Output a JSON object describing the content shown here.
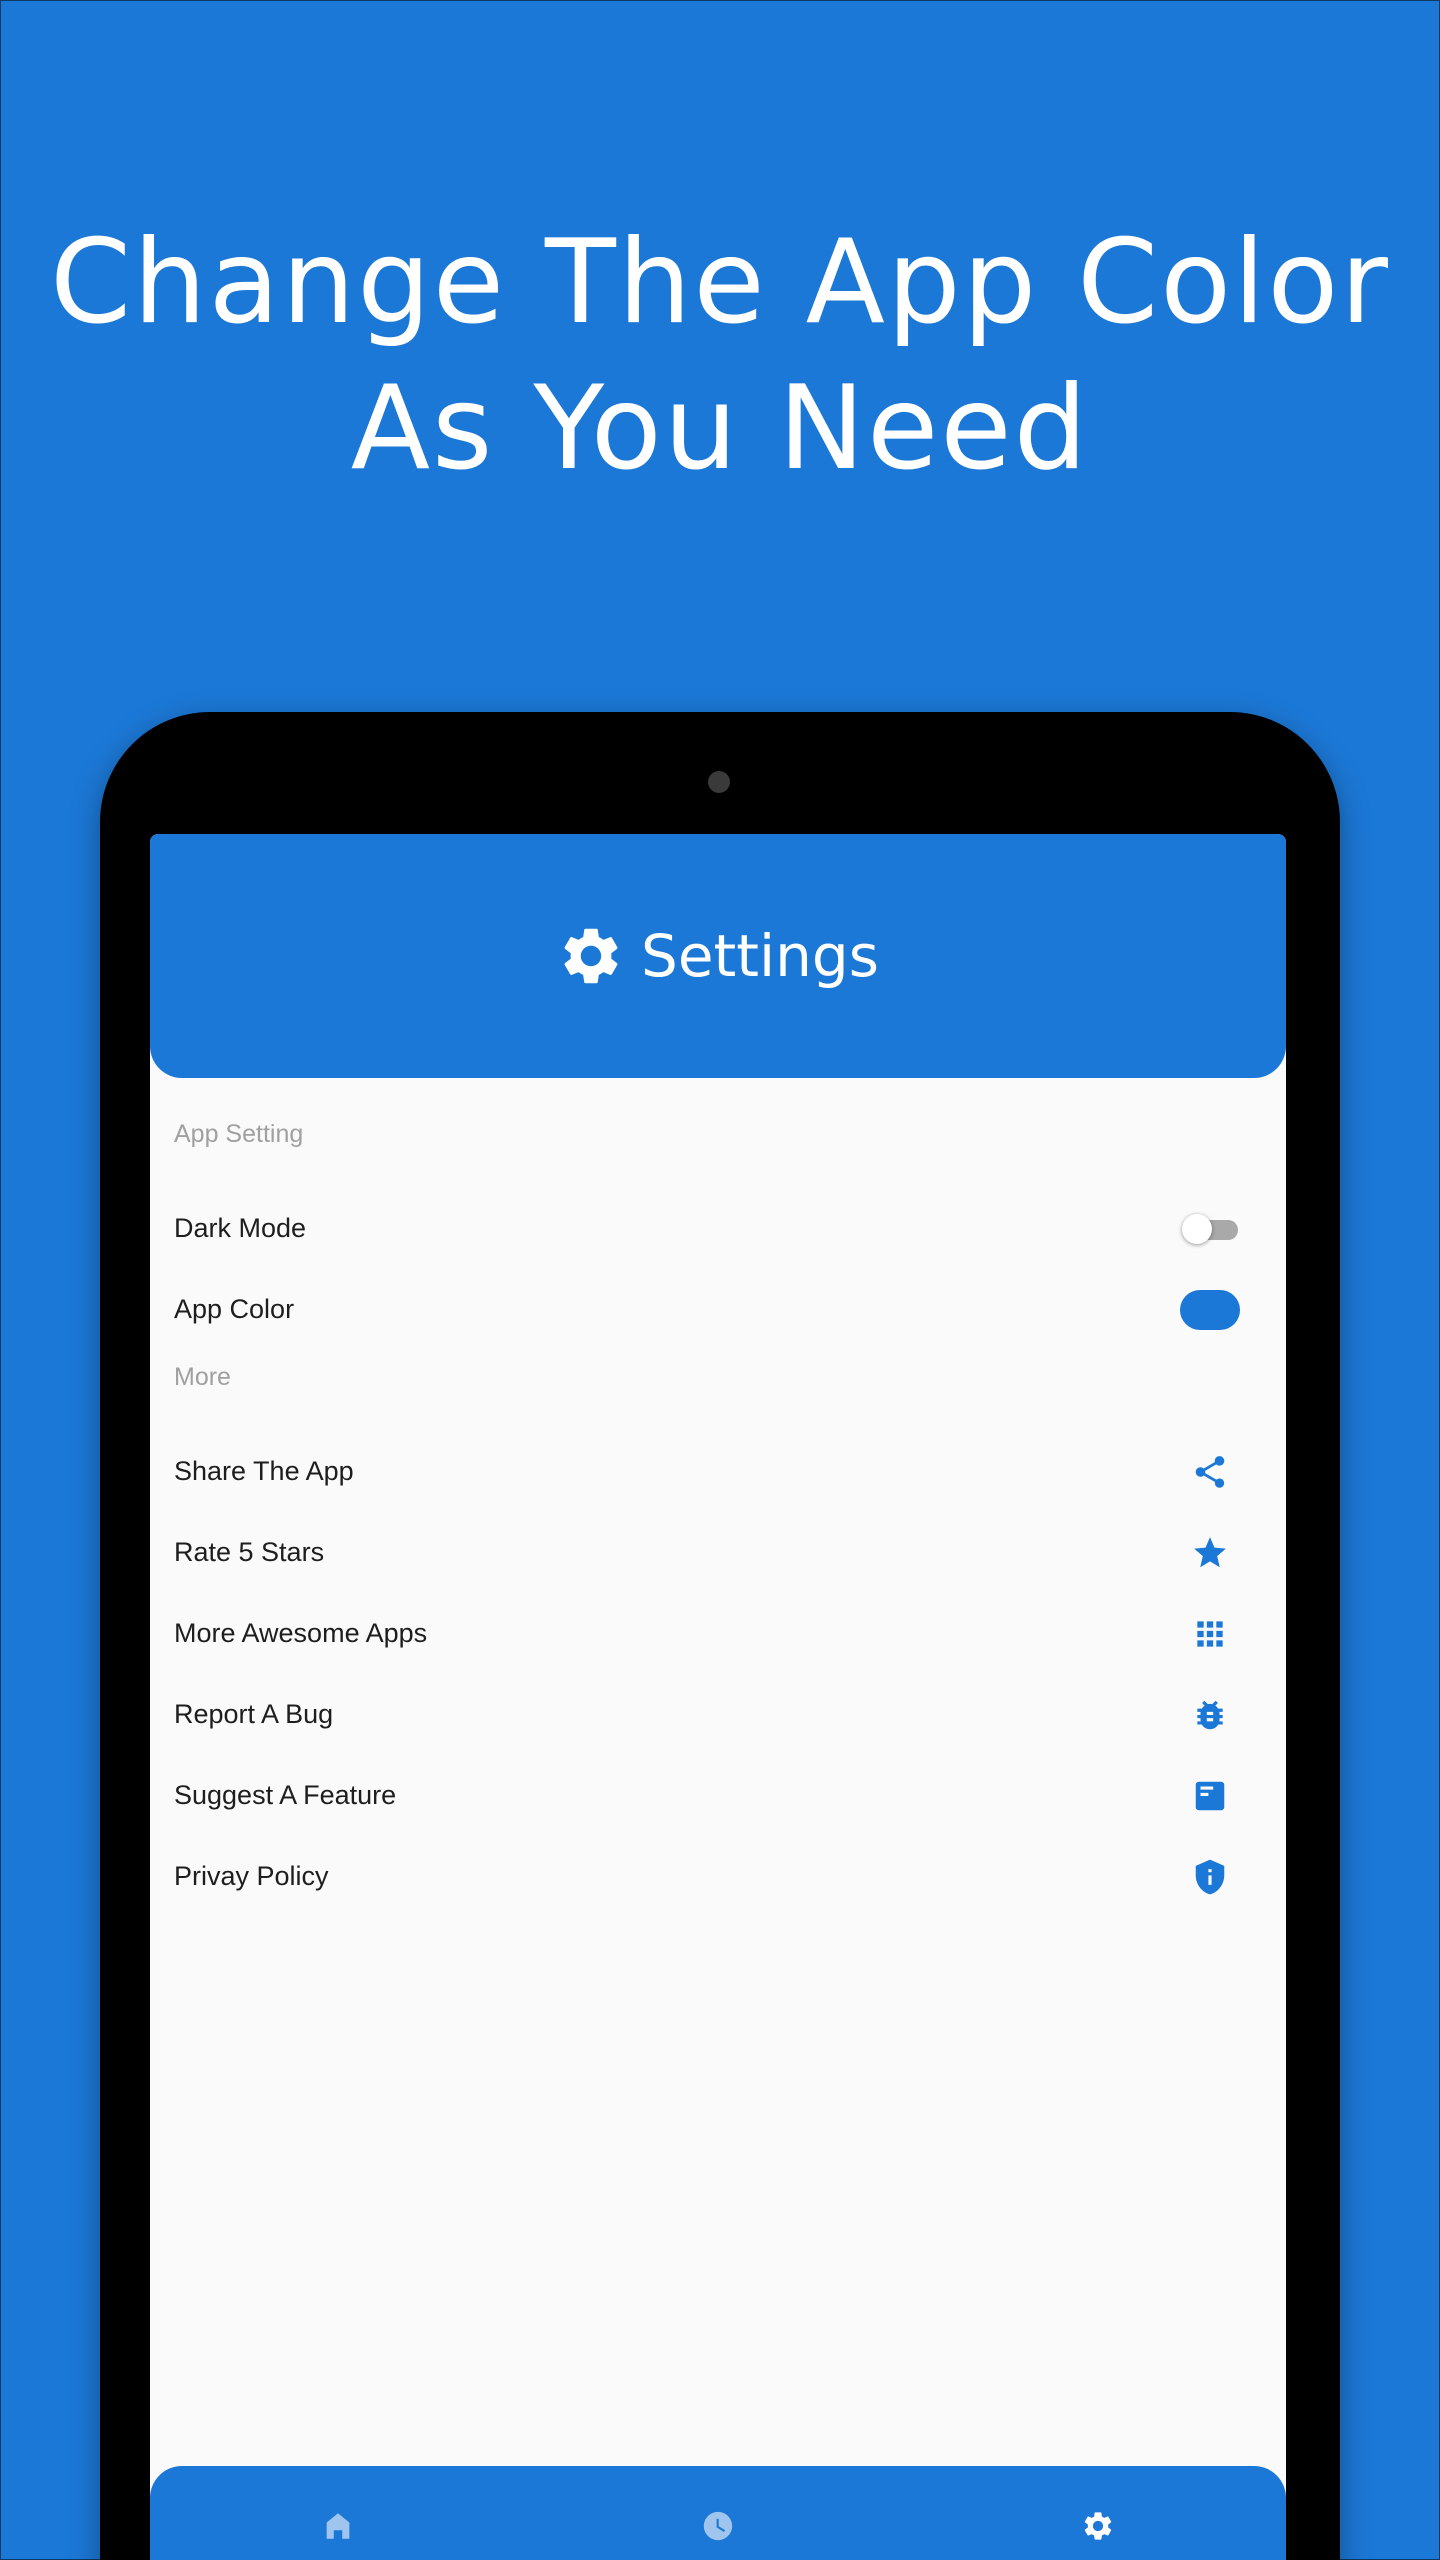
{
  "promo": {
    "headline_line1": "Change The App Color",
    "headline_line2": "As You Need"
  },
  "colors": {
    "brand_blue": "#1c78d6",
    "device_bezel": "#000000",
    "screen_bg": "#fafafa"
  },
  "app_header": {
    "icon": "gear-icon",
    "title": "Settings"
  },
  "sections": {
    "app_setting": "App Setting",
    "more": "More"
  },
  "app_settings": {
    "dark_mode": {
      "label": "Dark Mode",
      "enabled": false
    },
    "app_color": {
      "label": "App Color",
      "swatch": "#1c78d6"
    }
  },
  "more_items": [
    {
      "label": "Share The App",
      "icon": "share-icon"
    },
    {
      "label": "Rate 5 Stars",
      "icon": "star-icon"
    },
    {
      "label": "More Awesome Apps",
      "icon": "apps-grid-icon"
    },
    {
      "label": "Report A Bug",
      "icon": "bug-icon"
    },
    {
      "label": "Suggest A Feature",
      "icon": "feature-card-icon"
    },
    {
      "label": "Privay Policy",
      "icon": "shield-info-icon"
    }
  ],
  "bottom_nav": {
    "items": [
      {
        "icon": "home-icon",
        "active": false
      },
      {
        "icon": "clock-icon",
        "active": false
      },
      {
        "icon": "gear-icon",
        "active": true
      }
    ]
  }
}
